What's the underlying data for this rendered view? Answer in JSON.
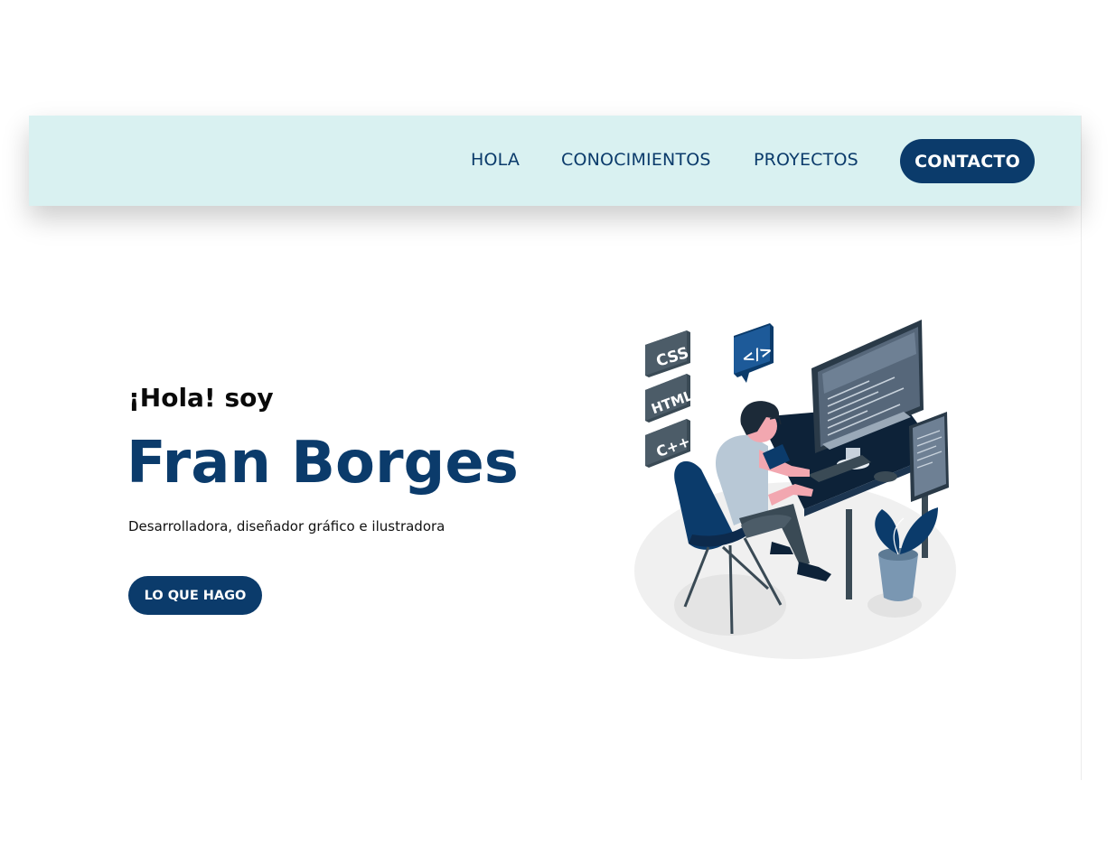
{
  "nav": {
    "links": [
      "HOLA",
      "CONOCIMIENTOS",
      "PROYECTOS"
    ],
    "cta_label": "CONTACTO"
  },
  "hero": {
    "greeting": "¡Hola! soy",
    "name": "Fran Borges",
    "subtitle": "Desarrolladora, diseñador gráfico e ilustradora",
    "cta_label": "LO QUE HAGO"
  },
  "illustration": {
    "tags": [
      "CSS",
      "HTML",
      "C++"
    ],
    "code_badge": "</>"
  },
  "colors": {
    "primary": "#0b3b6b",
    "nav_bg": "#d9f1f1",
    "text": "#0a0a0a"
  }
}
